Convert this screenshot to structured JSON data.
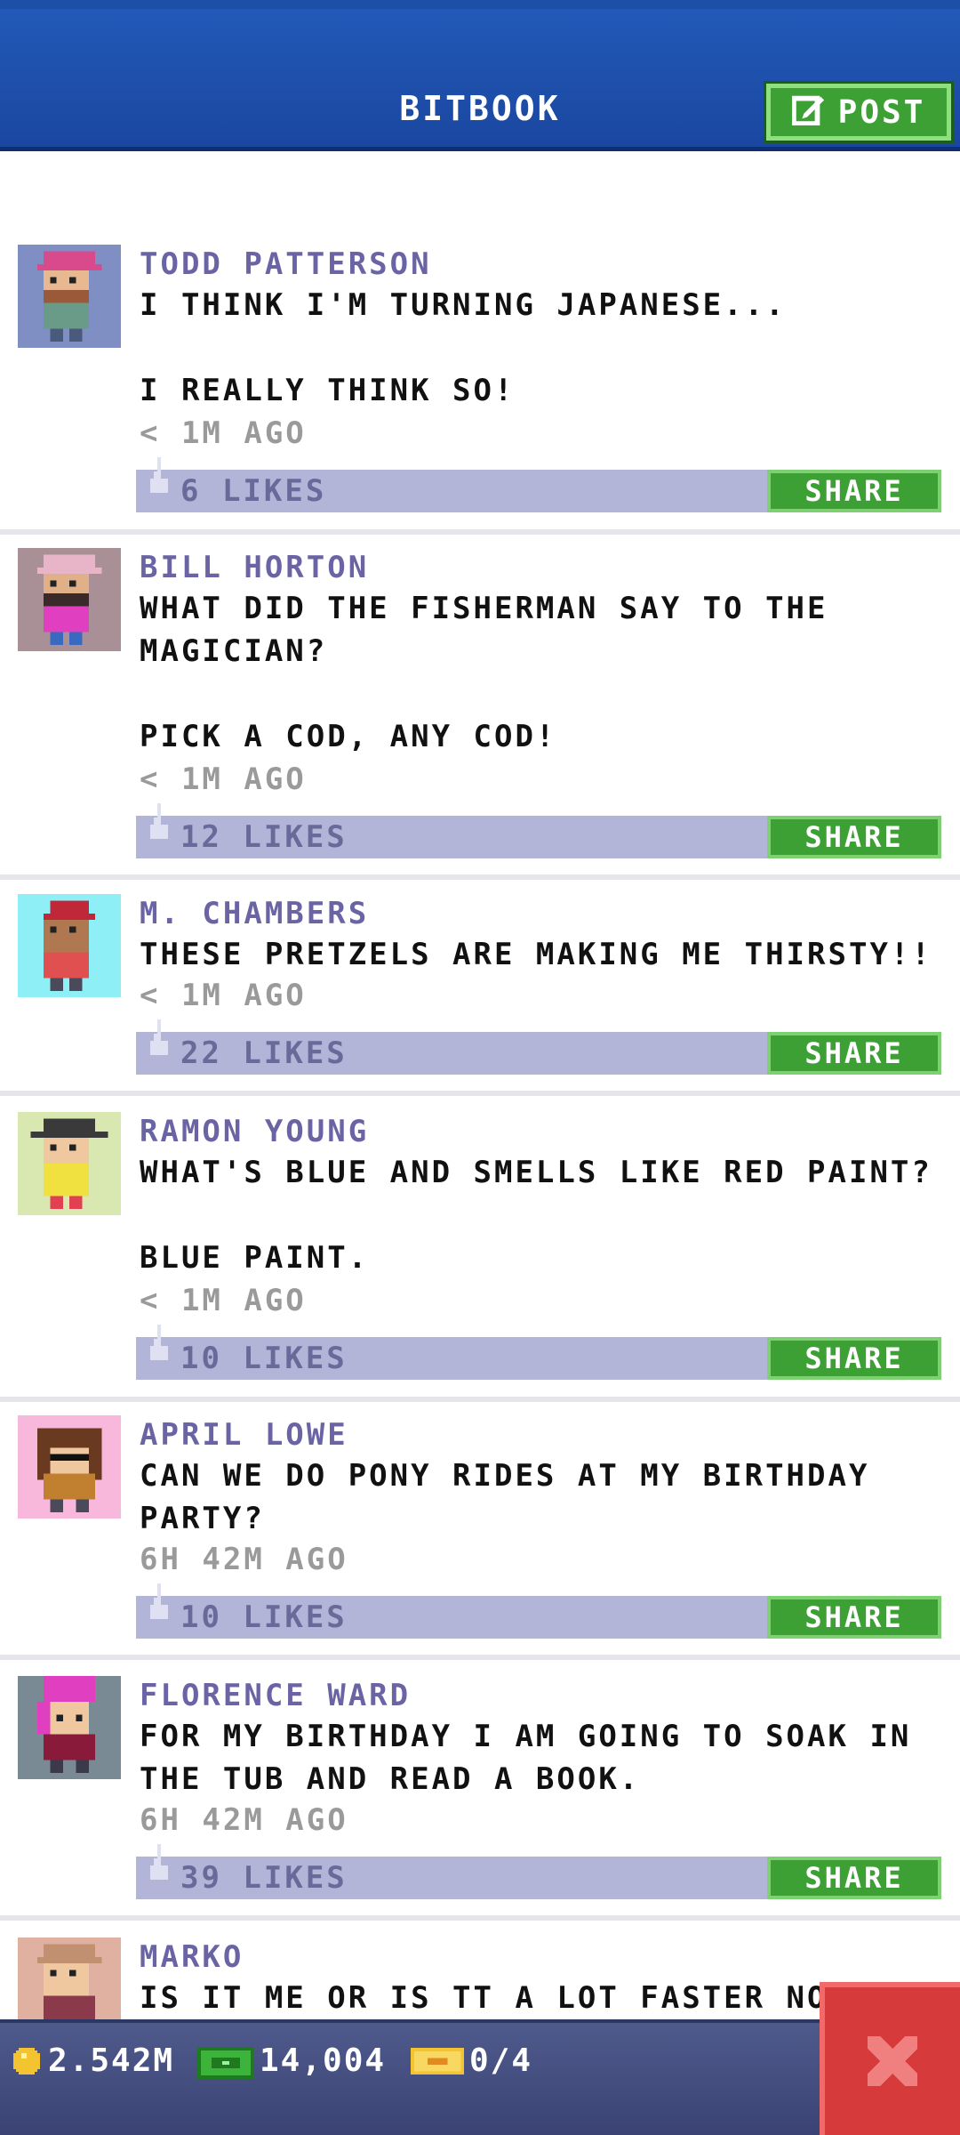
{
  "header": {
    "title": "BITBOOK",
    "post_label": "POST"
  },
  "posts": [
    {
      "author": "TODD PATTERSON",
      "text": "I THINK I'M TURNING JAPANESE...\n\nI REALLY THINK SO!",
      "time": "< 1M AGO",
      "likes": "6 LIKES",
      "share": "SHARE"
    },
    {
      "author": "BILL HORTON",
      "text": "WHAT DID THE FISHERMAN SAY TO THE MAGICIAN?\n\nPICK A COD, ANY COD!",
      "time": "< 1M AGO",
      "likes": "12 LIKES",
      "share": "SHARE"
    },
    {
      "author": "M. CHAMBERS",
      "text": "THESE PRETZELS ARE MAKING ME THIRSTY!!",
      "time": "< 1M AGO",
      "likes": "22 LIKES",
      "share": "SHARE"
    },
    {
      "author": "RAMON YOUNG",
      "text": "WHAT'S BLUE AND SMELLS LIKE RED PAINT?\n\nBLUE PAINT.",
      "time": "< 1M AGO",
      "likes": "10 LIKES",
      "share": "SHARE"
    },
    {
      "author": "APRIL LOWE",
      "text": "CAN WE DO PONY RIDES AT MY BIRTHDAY PARTY?",
      "time": "6H 42M AGO",
      "likes": "10 LIKES",
      "share": "SHARE"
    },
    {
      "author": "FLORENCE WARD",
      "text": "FOR MY BIRTHDAY I AM GOING TO SOAK IN THE TUB AND READ A BOOK.",
      "time": "6H 42M AGO",
      "likes": "39 LIKES",
      "share": "SHARE"
    },
    {
      "author": "MARKO",
      "text": "IS IT ME OR IS TT A LOT FASTER NOW IN",
      "time": "",
      "likes": "",
      "share": ""
    }
  ],
  "status": {
    "coins": "2.542M",
    "bux": "14,004",
    "tickets": "0/4"
  },
  "colors": {
    "header": "#1a47a0",
    "share": "#3da035",
    "likebar": "#b2b4d8",
    "author": "#6a64a4",
    "close": "#d63a3a"
  },
  "icons": {
    "post": "edit-icon",
    "like": "thumbs-up-icon",
    "coin": "coin-icon",
    "bux": "bux-icon",
    "ticket": "ticket-icon",
    "close": "close-icon"
  }
}
